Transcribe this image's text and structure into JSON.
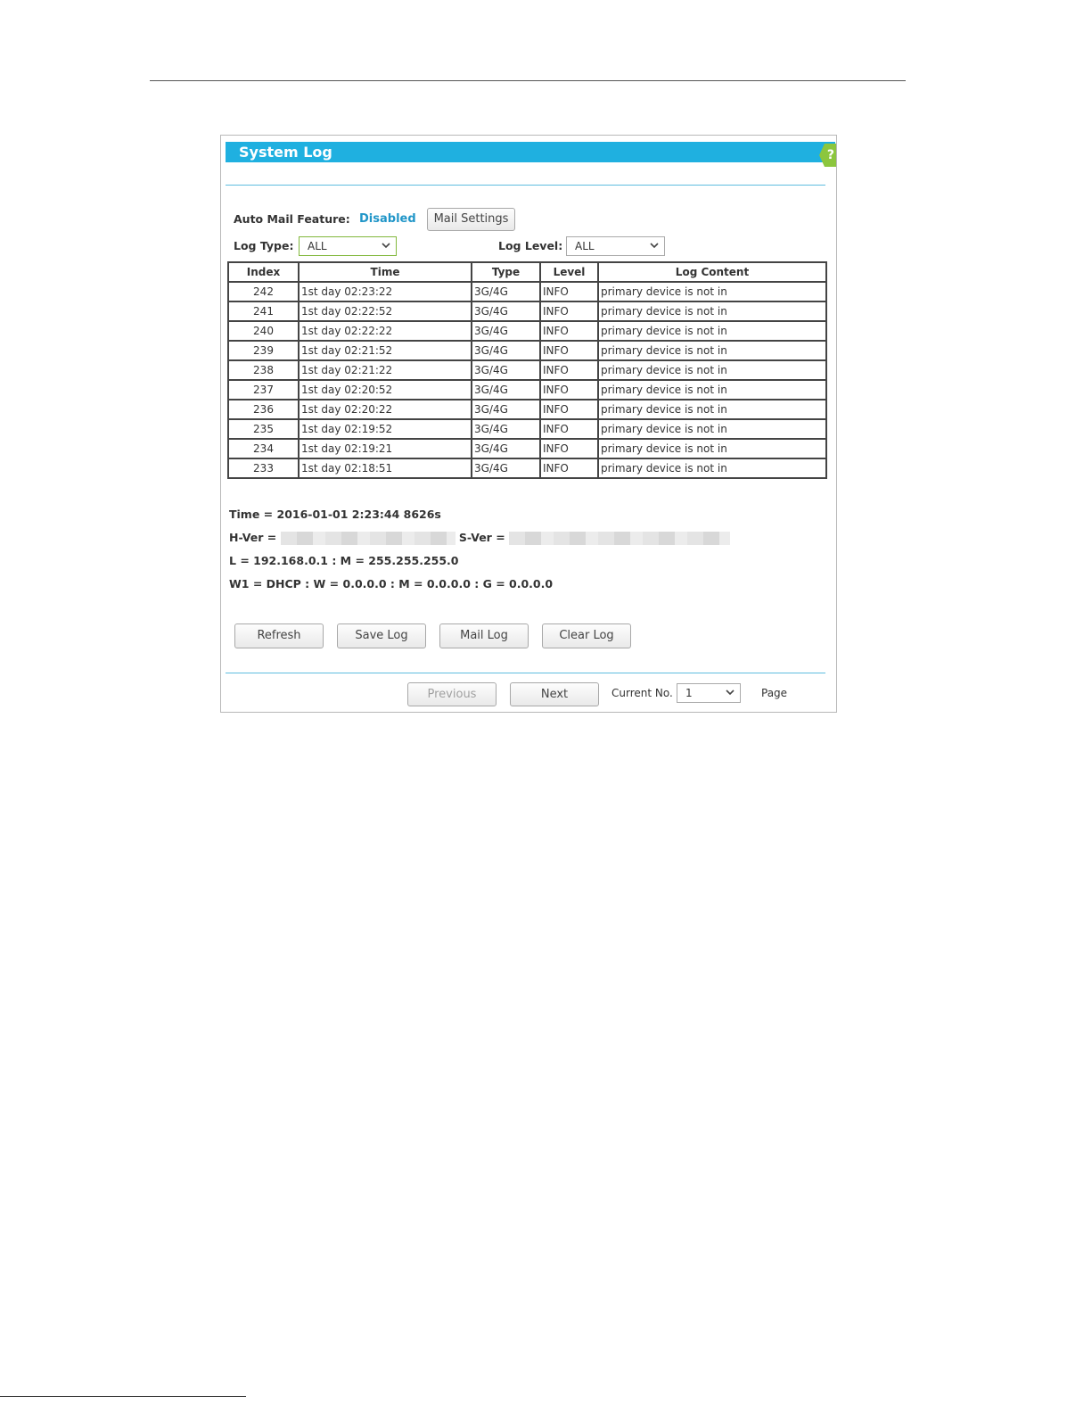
{
  "panel": {
    "title": "System Log",
    "help_glyph": "?"
  },
  "mail": {
    "label": "Auto Mail Feature:",
    "status": "Disabled",
    "settings_button": "Mail Settings"
  },
  "filters": {
    "log_type_label": "Log Type:",
    "log_type_value": "ALL",
    "log_level_label": "Log Level:",
    "log_level_value": "ALL"
  },
  "table": {
    "headers": [
      "Index",
      "Time",
      "Type",
      "Level",
      "Log Content"
    ],
    "rows": [
      {
        "index": "242",
        "time": "1st day 02:23:22",
        "type": "3G/4G",
        "level": "INFO",
        "content": "primary device is not in"
      },
      {
        "index": "241",
        "time": "1st day 02:22:52",
        "type": "3G/4G",
        "level": "INFO",
        "content": "primary device is not in"
      },
      {
        "index": "240",
        "time": "1st day 02:22:22",
        "type": "3G/4G",
        "level": "INFO",
        "content": "primary device is not in"
      },
      {
        "index": "239",
        "time": "1st day 02:21:52",
        "type": "3G/4G",
        "level": "INFO",
        "content": "primary device is not in"
      },
      {
        "index": "238",
        "time": "1st day 02:21:22",
        "type": "3G/4G",
        "level": "INFO",
        "content": "primary device is not in"
      },
      {
        "index": "237",
        "time": "1st day 02:20:52",
        "type": "3G/4G",
        "level": "INFO",
        "content": "primary device is not in"
      },
      {
        "index": "236",
        "time": "1st day 02:20:22",
        "type": "3G/4G",
        "level": "INFO",
        "content": "primary device is not in"
      },
      {
        "index": "235",
        "time": "1st day 02:19:52",
        "type": "3G/4G",
        "level": "INFO",
        "content": "primary device is not in"
      },
      {
        "index": "234",
        "time": "1st day 02:19:21",
        "type": "3G/4G",
        "level": "INFO",
        "content": "primary device is not in"
      },
      {
        "index": "233",
        "time": "1st day 02:18:51",
        "type": "3G/4G",
        "level": "INFO",
        "content": "primary device is not in"
      }
    ]
  },
  "info": {
    "time_line": "Time = 2016-01-01 2:23:44 8626s",
    "hver_label": "H-Ver = ",
    "sver_label": "S-Ver = ",
    "lan_line": "L = 192.168.0.1 : M = 255.255.255.0",
    "wan_line": "W1 = DHCP : W = 0.0.0.0 : M = 0.0.0.0 : G = 0.0.0.0"
  },
  "actions": {
    "refresh": "Refresh",
    "save_log": "Save Log",
    "mail_log": "Mail Log",
    "clear_log": "Clear Log"
  },
  "pagination": {
    "previous": "Previous",
    "next": "Next",
    "current_label": "Current No.",
    "current_value": "1",
    "page_label": "Page"
  },
  "icons": {
    "dropdown": "chevron-down-icon",
    "help": "help-icon"
  },
  "colors": {
    "title_bar": "#1fb0e0",
    "status_disabled": "#2196c8",
    "help_badge": "#8cc63e",
    "divider": "#5fbde0"
  }
}
